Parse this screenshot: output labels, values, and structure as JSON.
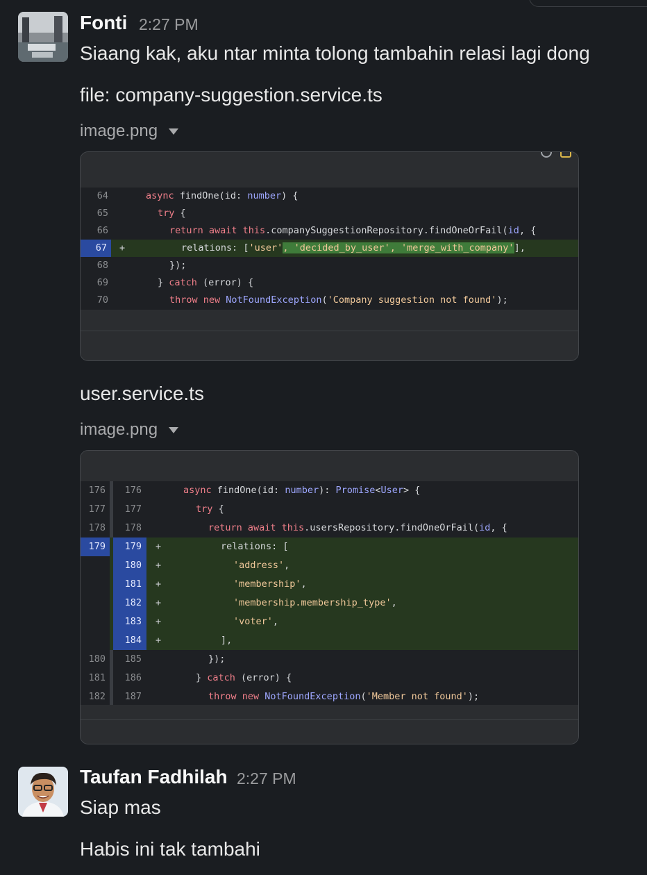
{
  "messages": [
    {
      "author": "Fonti",
      "time": "2:27 PM",
      "lines": [
        "Siaang kak, aku ntar minta tolong tambahin relasi lagi dong",
        "file: company-suggestion.service.ts"
      ],
      "attachment_label": "image.png"
    },
    {
      "text": "user.service.ts",
      "attachment_label": "image.png"
    },
    {
      "author": "Taufan Fadhilah",
      "time": "2:27 PM",
      "lines": [
        "Siap mas",
        "Habis ini tak tambahi"
      ]
    }
  ],
  "snippet1": {
    "rows": [
      {
        "ln": "64",
        "sign": "",
        "added": false
      },
      {
        "ln": "65",
        "sign": "",
        "added": false
      },
      {
        "ln": "66",
        "sign": "",
        "added": false
      },
      {
        "ln": "67",
        "sign": "+",
        "added": true
      },
      {
        "ln": "68",
        "sign": "",
        "added": false
      },
      {
        "ln": "69",
        "sign": "",
        "added": false
      },
      {
        "ln": "70",
        "sign": "",
        "added": false
      }
    ],
    "code": {
      "l64": {
        "a": "async",
        "b": " findOne(id: ",
        "c": "number",
        "d": ") {"
      },
      "l65": {
        "a": "try",
        "b": " {"
      },
      "l66": {
        "a": "return await this",
        "b": ".companySuggestionRepository.findOneOrFail(",
        "c": "id",
        "d": ", {"
      },
      "l67": {
        "a": "relations: [",
        "b": "'user'",
        "c": ", 'decided_by_user', 'merge_with_company'",
        "d": "],"
      },
      "l68": {
        "a": "});"
      },
      "l69": {
        "a": "} ",
        "b": "catch",
        "c": " (error) {"
      },
      "l70": {
        "a": "throw new ",
        "b": "NotFoundException",
        "c": "(",
        "d": "'Company suggestion not found'",
        "e": ");"
      }
    }
  },
  "snippet2": {
    "rows": [
      {
        "old": "176",
        "new": "176",
        "sign": "",
        "added": false
      },
      {
        "old": "177",
        "new": "177",
        "sign": "",
        "added": false
      },
      {
        "old": "178",
        "new": "178",
        "sign": "",
        "added": false
      },
      {
        "old": "179",
        "new": "179",
        "sign": "+",
        "added": true
      },
      {
        "old": "",
        "new": "180",
        "sign": "+",
        "added": true
      },
      {
        "old": "",
        "new": "181",
        "sign": "+",
        "added": true
      },
      {
        "old": "",
        "new": "182",
        "sign": "+",
        "added": true
      },
      {
        "old": "",
        "new": "183",
        "sign": "+",
        "added": true
      },
      {
        "old": "",
        "new": "184",
        "sign": "+",
        "added": true
      },
      {
        "old": "180",
        "new": "185",
        "sign": "",
        "added": false
      },
      {
        "old": "181",
        "new": "186",
        "sign": "",
        "added": false
      },
      {
        "old": "182",
        "new": "187",
        "sign": "",
        "added": false
      }
    ],
    "code": {
      "l176": {
        "a": "async",
        "b": " findOne(id: ",
        "c": "number",
        "d": "): ",
        "e": "Promise",
        "f": "<",
        "g": "User",
        "h": "> {"
      },
      "l177": {
        "a": "try",
        "b": " {"
      },
      "l178": {
        "a": "return await this",
        "b": ".usersRepository.findOneOrFail(",
        "c": "id",
        "d": ", {"
      },
      "l179": {
        "a": "relations: ["
      },
      "l180": {
        "a": "'address'",
        "b": ","
      },
      "l181": {
        "a": "'membership'",
        "b": ","
      },
      "l182": {
        "a": "'membership.membership_type'",
        "b": ","
      },
      "l183": {
        "a": "'voter'",
        "b": ","
      },
      "l184": {
        "a": "],"
      },
      "l185": {
        "a": "});"
      },
      "l186": {
        "a": "} ",
        "b": "catch",
        "c": " (error) {"
      },
      "l187": {
        "a": "throw new ",
        "b": "NotFoundException",
        "c": "(",
        "d": "'Member not found'",
        "e": ");"
      }
    }
  }
}
